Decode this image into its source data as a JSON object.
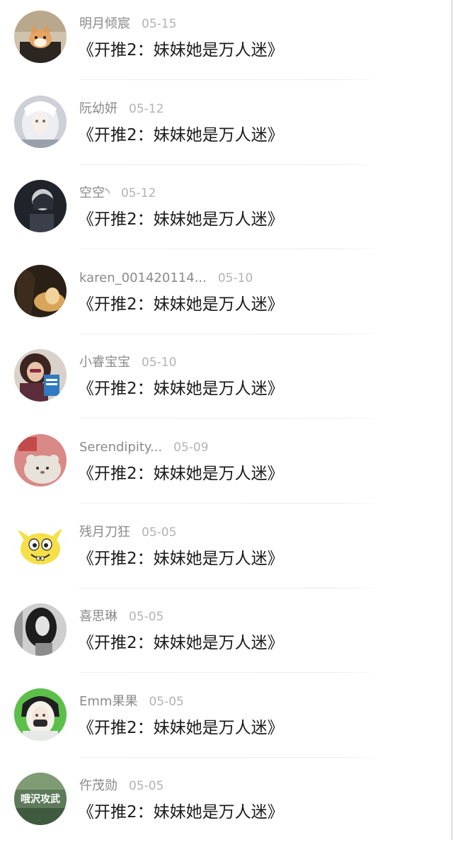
{
  "messages": [
    {
      "username": "明月倾宸",
      "time": "05-15",
      "text": "《开推2：妹妹她是万人迷》",
      "avatar": "kitten-avatar"
    },
    {
      "username": "阮幼妍",
      "time": "05-12",
      "text": "《开推2：妹妹她是万人迷》",
      "avatar": "white-hair-girl-avatar"
    },
    {
      "username": "空空◝",
      "time": "05-12",
      "text": "《开推2：妹妹她是万人迷》",
      "avatar": "dark-portrait-avatar"
    },
    {
      "username": "karen_001420114...",
      "time": "05-10",
      "text": "《开推2：妹妹她是万人迷》",
      "avatar": "warm-light-avatar"
    },
    {
      "username": "小睿宝宝",
      "time": "05-10",
      "text": "《开推2：妹妹她是万人迷》",
      "avatar": "girl-with-book-avatar"
    },
    {
      "username": "Serendipity...",
      "time": "05-09",
      "text": "《开推2：妹妹她是万人迷》",
      "avatar": "plush-toy-avatar"
    },
    {
      "username": "残月刀狂",
      "time": "05-05",
      "text": "《开推2：妹妹她是万人迷》",
      "avatar": "sponge-cartoon-avatar"
    },
    {
      "username": "喜思琳",
      "time": "05-05",
      "text": "《开推2：妹妹她是万人迷》",
      "avatar": "bw-portrait-avatar"
    },
    {
      "username": "Emm果果",
      "time": "05-05",
      "text": "《开推2：妹妹她是万人迷》",
      "avatar": "masked-anime-avatar"
    },
    {
      "username": "仵茂勋",
      "time": "05-05",
      "text": "《开推2：妹妹她是万人迷》",
      "avatar": "text-photo-avatar",
      "avatar_text": "哦沢攻武"
    }
  ]
}
